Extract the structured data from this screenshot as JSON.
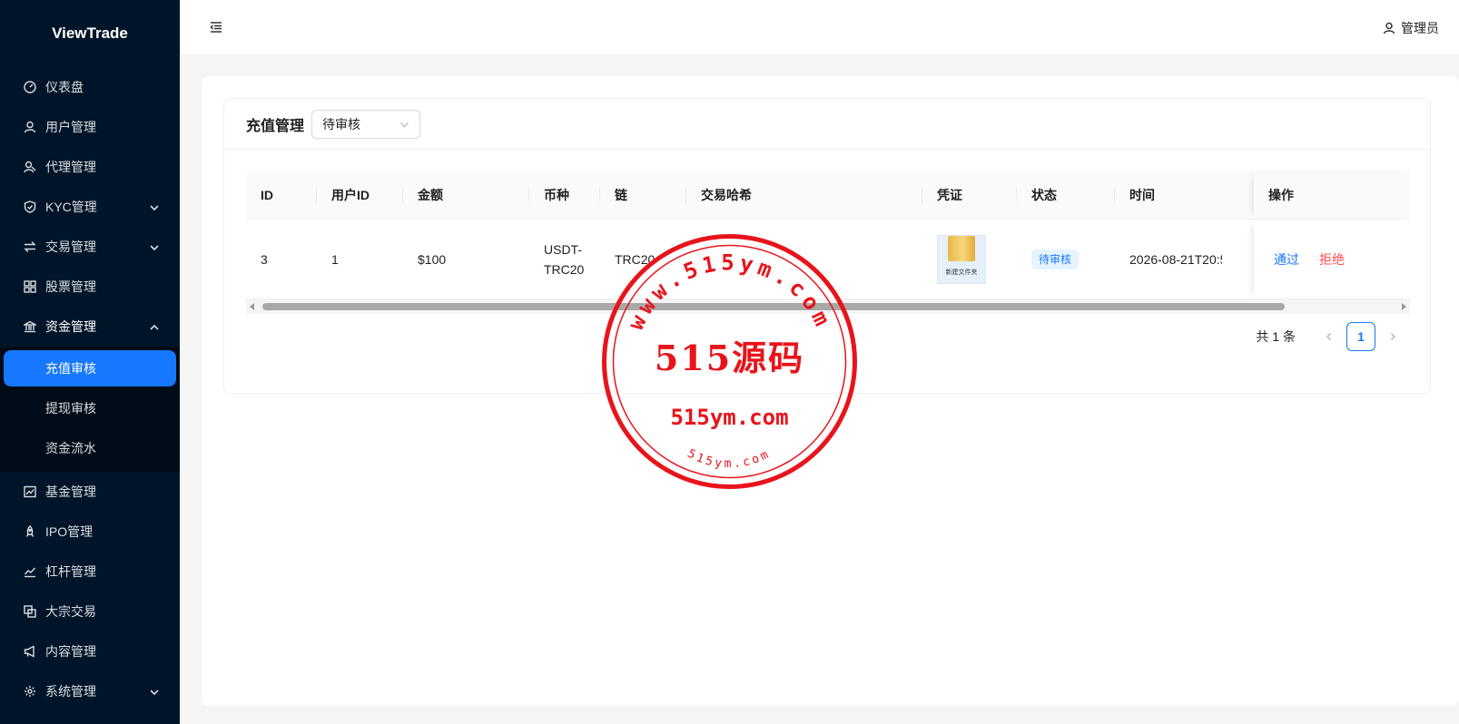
{
  "app": {
    "brand": "ViewTrade"
  },
  "sidebar": {
    "items": [
      {
        "label": "仪表盘",
        "icon": "dashboard-icon"
      },
      {
        "label": "用户管理",
        "icon": "user-icon"
      },
      {
        "label": "代理管理",
        "icon": "agent-icon"
      },
      {
        "label": "KYC管理",
        "icon": "shield-icon",
        "expandable": true
      },
      {
        "label": "交易管理",
        "icon": "swap-icon",
        "expandable": true
      },
      {
        "label": "股票管理",
        "icon": "grid-icon"
      },
      {
        "label": "资金管理",
        "icon": "bank-icon",
        "expanded": true
      },
      {
        "label": "基金管理",
        "icon": "fund-chart-icon"
      },
      {
        "label": "IPO管理",
        "icon": "rocket-icon"
      },
      {
        "label": "杠杆管理",
        "icon": "line-chart-icon"
      },
      {
        "label": "大宗交易",
        "icon": "block-icon"
      },
      {
        "label": "内容管理",
        "icon": "megaphone-icon"
      },
      {
        "label": "系统管理",
        "icon": "gear-icon",
        "expandable": true
      }
    ],
    "funds_submenu": [
      {
        "label": "充值审核",
        "active": true
      },
      {
        "label": "提现审核"
      },
      {
        "label": "资金流水"
      }
    ]
  },
  "header": {
    "user_label": "管理员"
  },
  "page": {
    "title": "充值管理",
    "filter_selected": "待审核"
  },
  "table": {
    "columns": [
      "ID",
      "用户ID",
      "金额",
      "币种",
      "链",
      "交易哈希",
      "凭证",
      "状态",
      "时间",
      "操作"
    ],
    "rows": [
      {
        "id": "3",
        "user_id": "1",
        "amount": "$100",
        "coin_line1": "USDT-",
        "coin_line2": "TRC20",
        "chain": "TRC20",
        "hash": "",
        "proof_caption": "新建文件夹",
        "status": "待审核",
        "time": "2026-08-21T20:5",
        "approve": "通过",
        "reject": "拒绝"
      }
    ]
  },
  "pagination": {
    "total_text": "共 1 条",
    "current_page": "1"
  },
  "watermark": {
    "center_text": "515源码",
    "domain_text": "515ym.com",
    "arc_top": "www.515ym.com",
    "arc_bottom": "515ym.com",
    "color": "#e8141b"
  },
  "colors": {
    "sidebar_bg": "#001529",
    "accent": "#1677ff",
    "danger": "#ff4d4f"
  }
}
